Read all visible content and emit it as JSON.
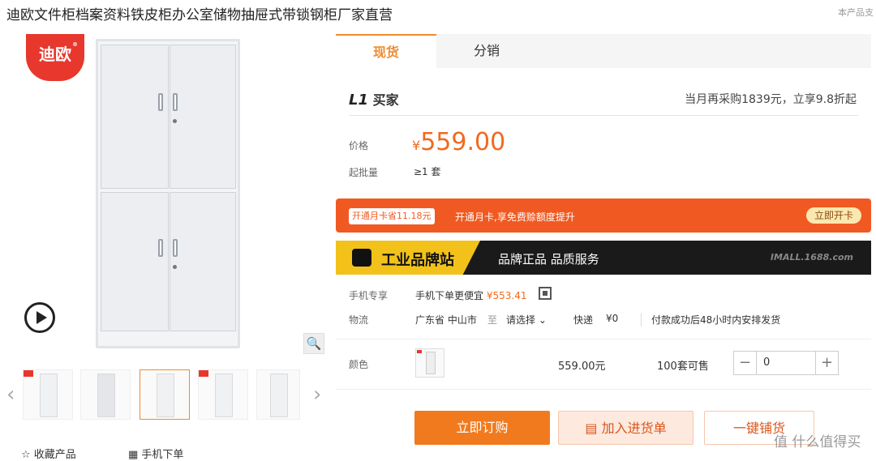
{
  "product": {
    "title": "迪欧文件柜档案资料铁皮柜办公室储物抽屉式带锁钢柜厂家直营",
    "support_note": "本产品支",
    "brand_logo": "迪欧",
    "brand_mark": "®"
  },
  "gallery": {
    "thumbnails": [
      "cabinet-front",
      "cabinet-handle",
      "cabinet-full",
      "cabinet-lock",
      "cabinet-side"
    ],
    "selected_index": 2,
    "collect_label": "收藏产品",
    "mobile_order_label": "手机下单"
  },
  "tabs": [
    {
      "label": "现货",
      "active": true
    },
    {
      "label": "分销",
      "active": false
    }
  ],
  "buyer": {
    "level": "L1",
    "level_label": "买家",
    "repurchase": "当月再采购1839元，立享9.8折起"
  },
  "pricing": {
    "price_label": "价格",
    "currency": "¥",
    "price": "559.00",
    "moq_label": "起批量",
    "moq": "≥1 套"
  },
  "monthly_card": {
    "badge": "开通月卡省11.18元",
    "text": "开通月卡,享免费赊额度提升",
    "button": "立即开卡"
  },
  "brand_banner": {
    "name": "工业品牌站",
    "slogan": "品牌正品  品质服务",
    "site": "IMALL.1688.com"
  },
  "mobile": {
    "label": "手机专享",
    "text": "手机下单更便宜",
    "price": "¥553.41"
  },
  "logistics": {
    "label": "物流",
    "origin": "广东省 中山市",
    "to": "至",
    "select": "请选择",
    "express": "快递",
    "fee": "¥0",
    "note": "付款成功后48小时内安排发货"
  },
  "variant": {
    "label": "颜色",
    "price": "559.00元",
    "stock": "100套可售",
    "quantity": "0",
    "minus": "−",
    "plus": "+"
  },
  "actions": {
    "buy": "立即订购",
    "cart": "加入进货单",
    "one_click": "一键铺货"
  },
  "watermark": "值 什么值得买",
  "colors": {
    "accent": "#f27a1e",
    "brand_red": "#e8372c",
    "banner_red": "#f05a22",
    "brand_yellow": "#f2c21b"
  }
}
